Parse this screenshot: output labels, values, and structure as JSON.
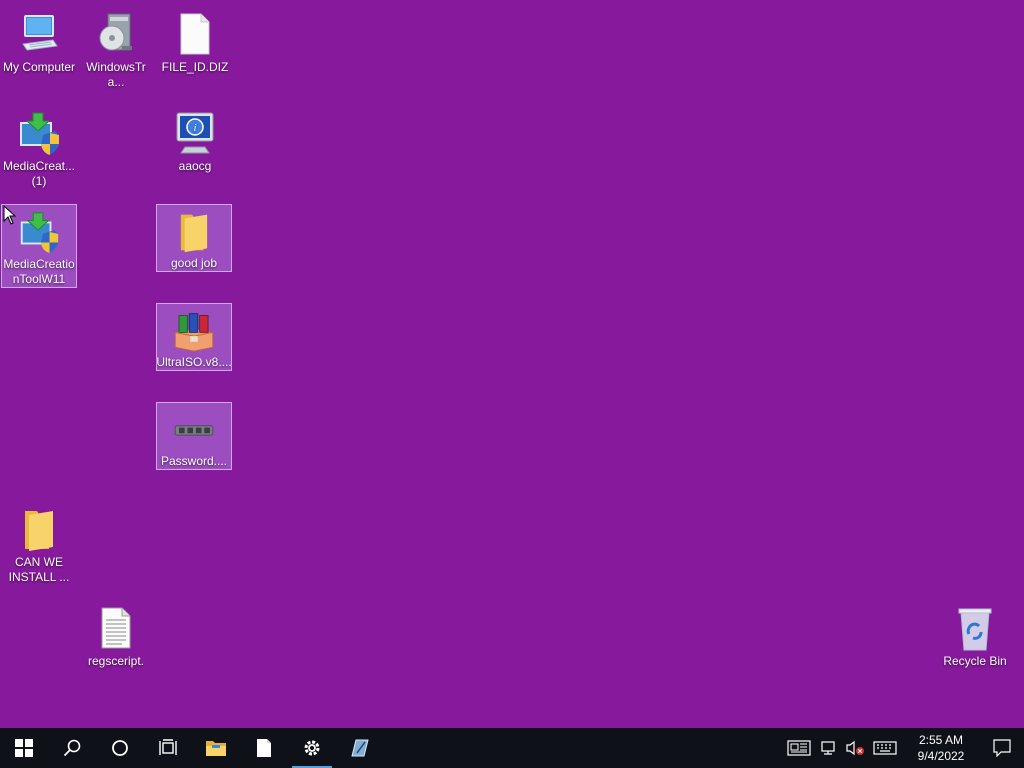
{
  "desktop": {
    "icons": [
      {
        "label": "My Computer",
        "icon": "my-computer-icon"
      },
      {
        "label": "WindowsTra...",
        "icon": "windows-installer-icon"
      },
      {
        "label": "FILE_ID.DIZ",
        "icon": "blank-file-icon"
      },
      {
        "label": "MediaCreat...\n(1)",
        "icon": "media-creation-tool-icon"
      },
      {
        "label": "aaocg",
        "icon": "info-monitor-icon"
      },
      {
        "label": "MediaCreatio\nnToolW11",
        "icon": "media-creation-tool-icon"
      },
      {
        "label": "good job",
        "icon": "folder-icon"
      },
      {
        "label": "UltraISO.v8....",
        "icon": "winrar-archive-icon"
      },
      {
        "label": "Password....",
        "icon": "password-tool-icon"
      },
      {
        "label": "CAN WE\nINSTALL ...",
        "icon": "folder-icon"
      },
      {
        "label": "regsceript.",
        "icon": "text-document-icon"
      },
      {
        "label": "Recycle Bin",
        "icon": "recycle-bin-icon"
      }
    ]
  },
  "taskbar": {
    "buttons": [
      "start-icon",
      "search-icon",
      "cortana-icon",
      "task-view-icon",
      "file-explorer-icon",
      "notepad-icon",
      "settings-icon",
      "pen-app-icon"
    ],
    "clock": {
      "time": "2:55 AM",
      "date": "9/4/2022"
    }
  },
  "colors": {
    "desktop_bg": "#871a9c",
    "taskbar_bg": "#0f1118",
    "accent": "#4da3e8"
  }
}
